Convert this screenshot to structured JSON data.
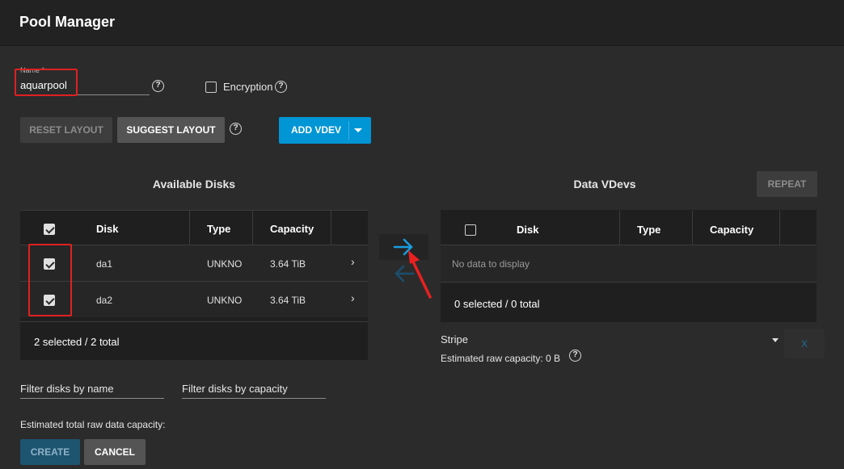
{
  "header": {
    "title": "Pool Manager"
  },
  "name_field": {
    "label": "Name *",
    "value": "aquarpool"
  },
  "encryption": {
    "label": "Encryption",
    "checked": false
  },
  "buttons": {
    "reset_layout": "RESET LAYOUT",
    "suggest_layout": "SUGGEST LAYOUT",
    "add_vdev": "ADD VDEV",
    "repeat": "REPEAT",
    "create": "CREATE",
    "cancel": "CANCEL"
  },
  "available_disks": {
    "title": "Available Disks",
    "columns": [
      "Disk",
      "Type",
      "Capacity"
    ],
    "rows": [
      {
        "disk": "da1",
        "type": "UNKNO",
        "capacity": "3.64 TiB",
        "checked": true
      },
      {
        "disk": "da2",
        "type": "UNKNO",
        "capacity": "3.64 TiB",
        "checked": true
      }
    ],
    "footer": "2 selected / 2 total"
  },
  "data_vdevs": {
    "title": "Data VDevs",
    "columns": [
      "Disk",
      "Type",
      "Capacity"
    ],
    "empty_text": "No data to display",
    "footer": "0 selected / 0 total",
    "layout": "Stripe",
    "estimated_raw": "Estimated raw capacity: 0 B",
    "remove_label": "X"
  },
  "filters": {
    "by_name": "Filter disks by name",
    "by_capacity": "Filter disks by capacity"
  },
  "estimated_total": "Estimated total raw data capacity:",
  "colors": {
    "accent": "#0095d5",
    "annotation": "#e02020",
    "background": "#2b2b2b",
    "table": "#1f1f1f"
  }
}
